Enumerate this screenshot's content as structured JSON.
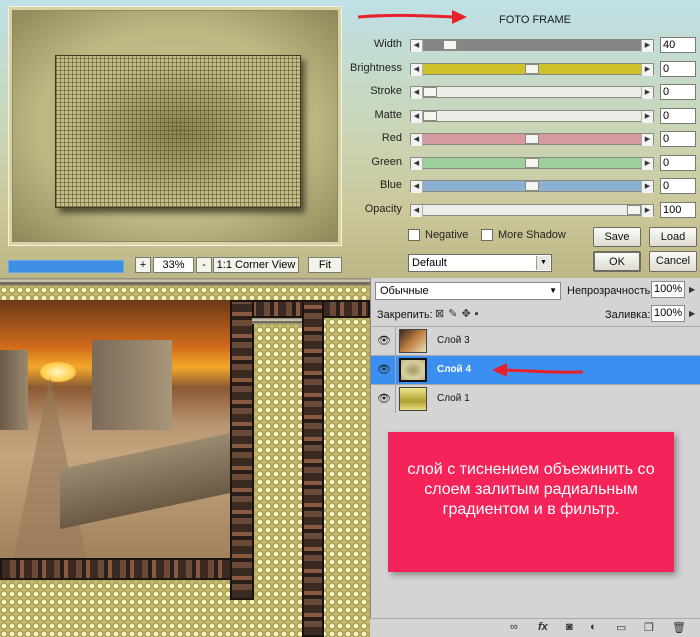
{
  "dialog": {
    "title": "FOTO FRAME",
    "sliders": [
      {
        "label": "Width",
        "value": "40",
        "level": 0.1,
        "color": "#858585"
      },
      {
        "label": "Brightness",
        "value": "0",
        "level": 0.5,
        "color": "#cfc12a"
      },
      {
        "label": "Stroke",
        "value": "0",
        "level": 0.0,
        "color": "#ecede7"
      },
      {
        "label": "Matte",
        "value": "0",
        "level": 0.0,
        "color": "#ecede7"
      },
      {
        "label": "Red",
        "value": "0",
        "level": 0.5,
        "color": "#d59a9f"
      },
      {
        "label": "Green",
        "value": "0",
        "level": 0.5,
        "color": "#9ccf9c"
      },
      {
        "label": "Blue",
        "value": "0",
        "level": 0.5,
        "color": "#8ab0d4"
      },
      {
        "label": "Opacity",
        "value": "100",
        "level": 1.0,
        "color": "#ecede7"
      }
    ],
    "negative_label": "Negative",
    "more_shadow_label": "More Shadow",
    "save_label": "Save",
    "load_label": "Load",
    "ok_label": "OK",
    "cancel_label": "Cancel",
    "preset_value": "Default",
    "zoom_in_label": "+",
    "zoom_out_label": "-",
    "zoom_value": "33%",
    "corner_view_label": "1:1 Corner View",
    "fit_label": "Fit"
  },
  "layers_panel": {
    "blend_mode": "Обычные",
    "opacity_label": "Непрозрачность:",
    "opacity_value": "100%",
    "lock_label": "Закрепить:",
    "fill_label": "Заливка:",
    "fill_value": "100%",
    "layers": [
      {
        "name": "Слой 3",
        "selected": false
      },
      {
        "name": "Слой 4",
        "selected": true
      },
      {
        "name": "Слой 1",
        "selected": false
      }
    ]
  },
  "note": {
    "text": "слой с тиснением объежинить со слоем залитым радиальным градиентом и в фильтр."
  },
  "icons": {
    "eye": "eye-icon",
    "lock": "lock-icon",
    "link": "link-icon",
    "fx": "fx-icon",
    "mask": "mask-icon",
    "adjustment": "adjustment-icon",
    "folder": "folder-icon",
    "new_layer": "new-layer-icon",
    "trash": "trash-icon"
  },
  "colors": {
    "accent_selected": "#3b8ff0",
    "note_bg": "#f4245a",
    "arrow": "#e8202a"
  }
}
